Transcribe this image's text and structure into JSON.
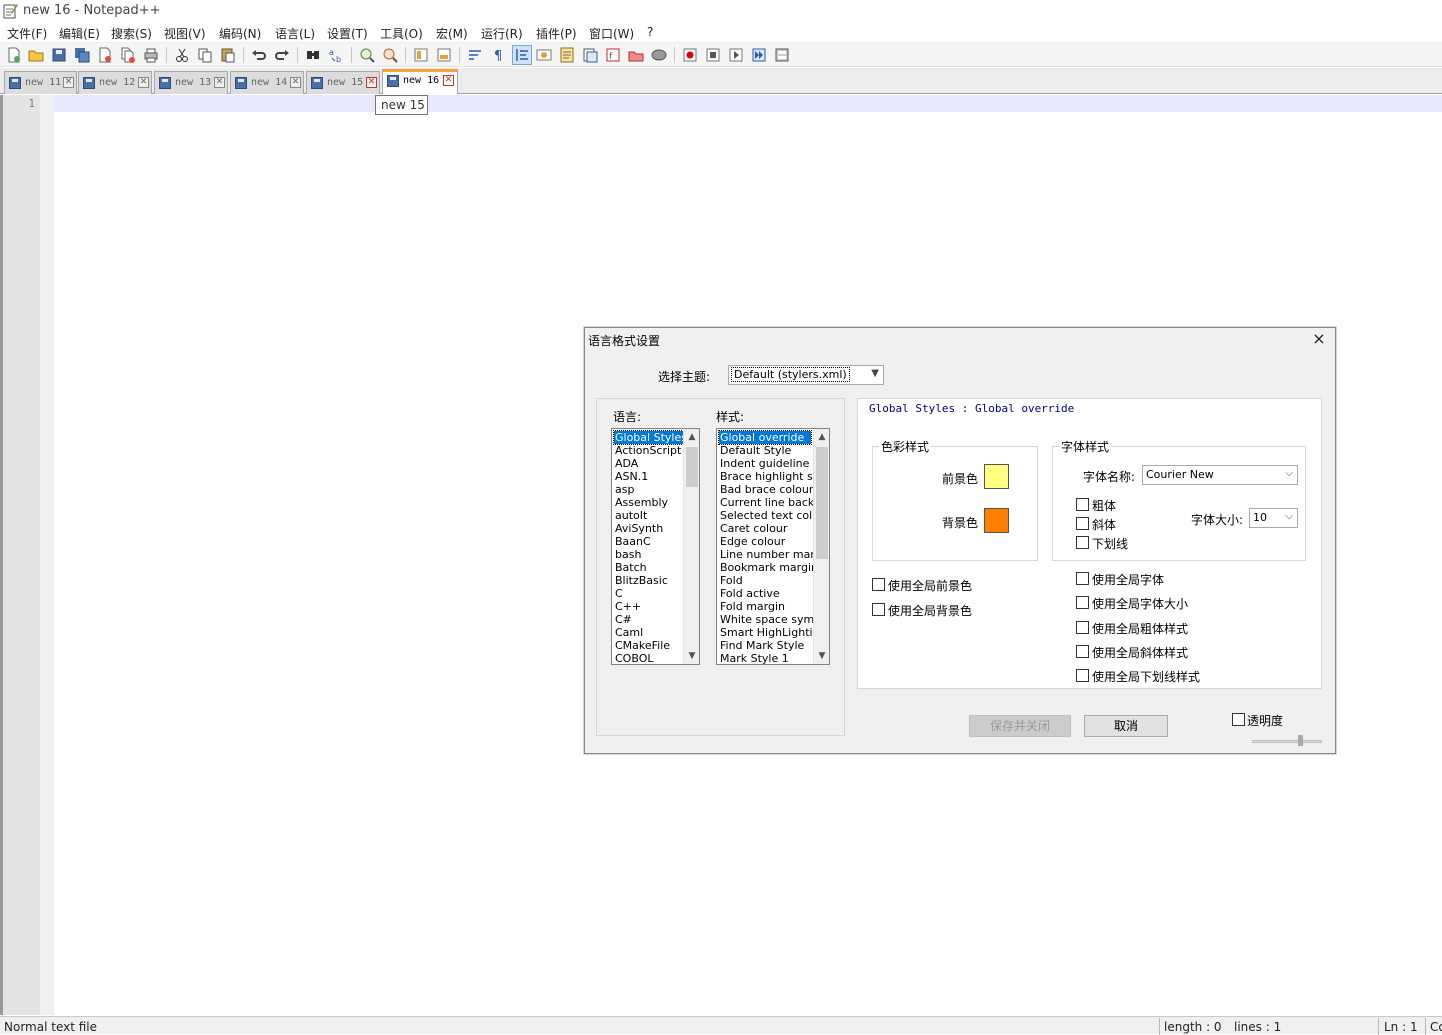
{
  "window": {
    "title": "new 16 - Notepad++"
  },
  "menu": [
    "文件(F)",
    "编辑(E)",
    "搜索(S)",
    "视图(V)",
    "编码(N)",
    "语言(L)",
    "设置(T)",
    "工具(O)",
    "宏(M)",
    "运行(R)",
    "插件(P)",
    "窗口(W)",
    "?"
  ],
  "toolbar": {
    "buttons": [
      "new-file-icon",
      "open-file-icon",
      "save-icon",
      "save-all-icon",
      "close-icon",
      "close-all-icon",
      "print-icon",
      "cut-icon",
      "copy-icon",
      "paste-icon",
      "undo-icon",
      "redo-icon",
      "find-icon",
      "replace-icon",
      "zoom-in-icon",
      "zoom-out-icon",
      "sync-vertical-icon",
      "sync-horizontal-icon",
      "word-wrap-icon",
      "show-all-chars-icon",
      "indent-guide-icon",
      "user-language-icon",
      "document-map-icon",
      "function-list-icon",
      "folder-workspace-icon",
      "monitoring-icon",
      "bubble-icon",
      "record-macro-icon",
      "stop-record-icon",
      "play-macro-icon",
      "run-macro-multiple-icon",
      "save-macro-icon"
    ]
  },
  "tabs": [
    {
      "label": "new 11",
      "active": false
    },
    {
      "label": "new 12",
      "active": false
    },
    {
      "label": "new 13",
      "active": false
    },
    {
      "label": "new 14",
      "active": false
    },
    {
      "label": "new 15",
      "active": false
    },
    {
      "label": "new 16",
      "active": true
    }
  ],
  "tooltip": "new 15",
  "editor": {
    "line_number": "1"
  },
  "status": {
    "file_type": "Normal text file",
    "length": "length : 0",
    "lines": "lines : 1",
    "position": "Ln : 1",
    "col": "Co"
  },
  "dialog": {
    "title": "语言格式设置",
    "close": "×",
    "theme_label": "选择主题:",
    "theme_value": "Default (stylers.xml)",
    "language_label": "语言:",
    "style_label": "样式:",
    "languages": [
      "Global Styles",
      "ActionScript",
      "ADA",
      "ASN.1",
      "asp",
      "Assembly",
      "autoIt",
      "AviSynth",
      "BaanC",
      "bash",
      "Batch",
      "BlitzBasic",
      "C",
      "C++",
      "C#",
      "Caml",
      "CMakeFile",
      "COBOL"
    ],
    "styles": [
      "Global override",
      "Default Style",
      "Indent guideline sty",
      "Brace highlight style",
      "Bad brace colour",
      "Current line backgr",
      "Selected text colou",
      "Caret colour",
      "Edge colour",
      "Line number margin",
      "Bookmark margin",
      "Fold",
      "Fold active",
      "Fold margin",
      "White space symbo",
      "Smart HighLighting",
      "Find Mark Style",
      "Mark Style 1"
    ],
    "description": "Global Styles : Global override",
    "color_group": "色彩样式",
    "fg_label": "前景色",
    "bg_label": "背景色",
    "fg_color": "#ffff80",
    "bg_color": "#ff8000",
    "font_group": "字体样式",
    "font_name_label": "字体名称:",
    "font_name": "Courier New",
    "bold": "粗体",
    "italic": "斜体",
    "underline": "下划线",
    "font_size_label": "字体大小:",
    "font_size": "10",
    "use_global_fg": "使用全局前景色",
    "use_global_bg": "使用全局背景色",
    "use_global_font": "使用全局字体",
    "use_global_size": "使用全局字体大小",
    "use_global_bold": "使用全局粗体样式",
    "use_global_italic": "使用全局斜体样式",
    "use_global_underline": "使用全局下划线样式",
    "save_close": "保存并关闭",
    "cancel": "取消",
    "transparency": "透明度"
  }
}
